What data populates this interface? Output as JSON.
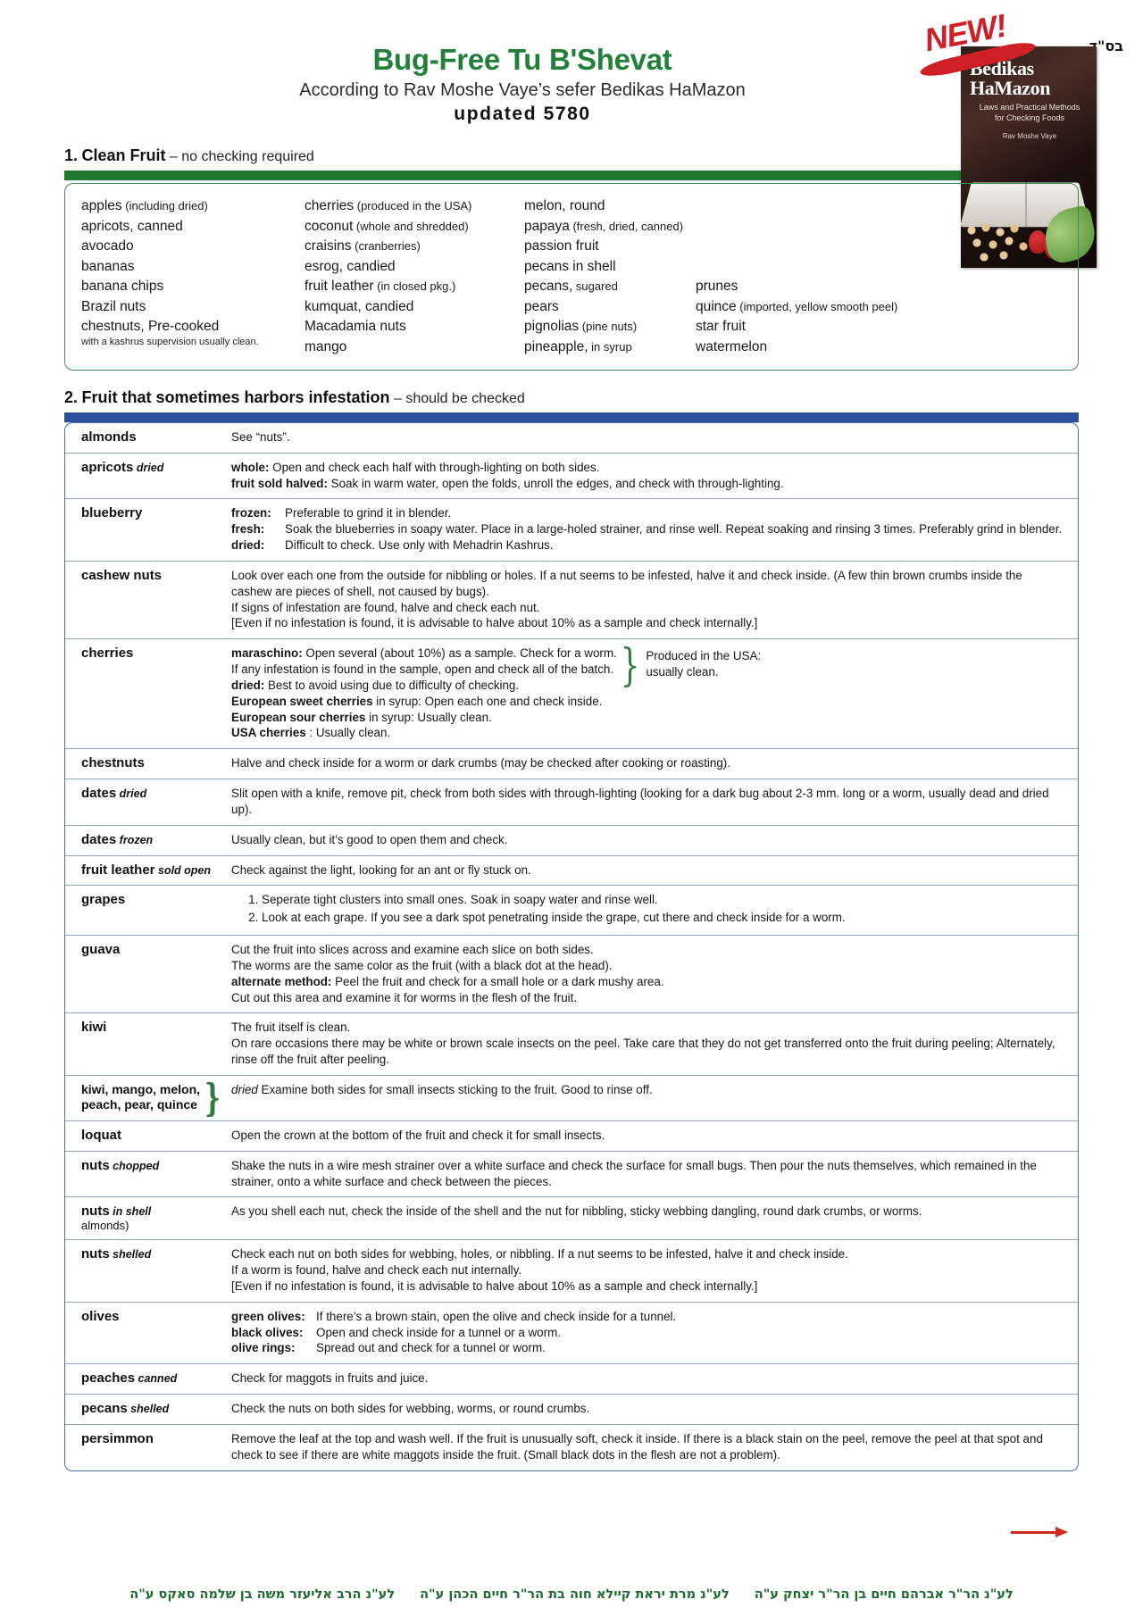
{
  "header": {
    "bsd": "בס\"ד",
    "title": "Bug-Free Tu B'Shevat",
    "subtitle": "According to Rav Moshe Vaye’s sefer Bedikas HaMazon",
    "updated": "updated 5780",
    "badge": "NEW!",
    "book": {
      "title_line1": "Bedikas",
      "title_line2": "HaMazon",
      "subtitle_line1": "Laws and Practical Methods",
      "subtitle_line2": "for Checking Foods",
      "author": "Rav Moshe Vaye"
    }
  },
  "section1": {
    "number": "1.",
    "title": "Clean Fruit",
    "note": "– no checking required",
    "columns": [
      [
        {
          "main": "apples",
          "small": "(including dried)"
        },
        {
          "main": "apricots, canned",
          "small": ""
        },
        {
          "main": "avocado",
          "small": ""
        },
        {
          "main": "bananas",
          "small": ""
        },
        {
          "main": "banana chips",
          "small": ""
        },
        {
          "main": "Brazil nuts",
          "small": ""
        },
        {
          "main": "chestnuts, Pre-cooked",
          "small": ""
        }
      ],
      [
        {
          "main": "cherries",
          "small": "(produced in the USA)"
        },
        {
          "main": "coconut",
          "small": "(whole and shredded)"
        },
        {
          "main": "craisins",
          "small": "(cranberries)"
        },
        {
          "main": "esrog, candied",
          "small": ""
        },
        {
          "main": "fruit leather",
          "small": "(in closed pkg.)"
        },
        {
          "main": "kumquat, candied",
          "small": ""
        },
        {
          "main": "Macadamia nuts",
          "small": ""
        },
        {
          "main": "mango",
          "small": ""
        }
      ],
      [
        {
          "main": "melon, round",
          "small": ""
        },
        {
          "main": "papaya",
          "small": "(fresh, dried, canned)"
        },
        {
          "main": "passion fruit",
          "small": ""
        },
        {
          "main": "pecans in shell",
          "small": ""
        },
        {
          "main": "pecans,",
          "small": "sugared"
        },
        {
          "main": "pears",
          "small": ""
        },
        {
          "main": "pignolias",
          "small": "(pine nuts)"
        },
        {
          "main": "pineapple,",
          "small": "in syrup"
        }
      ],
      [
        {
          "main": "",
          "small": ""
        },
        {
          "main": "",
          "small": ""
        },
        {
          "main": "",
          "small": ""
        },
        {
          "main": "",
          "small": ""
        },
        {
          "main": "prunes",
          "small": ""
        },
        {
          "main": "quince",
          "small": "(imported, yellow smooth peel)"
        },
        {
          "main": "star fruit",
          "small": ""
        },
        {
          "main": "watermelon",
          "small": ""
        }
      ]
    ],
    "chestnut_note": "with a kashrus supervision usually clean."
  },
  "section2": {
    "number": "2.",
    "title": "Fruit that sometimes harbors infestation",
    "note": "– should be checked",
    "rows": [
      {
        "key": "almonds",
        "key_italic": "",
        "lines": [
          {
            "text": "See “nuts”."
          }
        ]
      },
      {
        "key": "apricots",
        "key_italic": "dried",
        "lines": [
          {
            "label": "whole:",
            "text": "Open and check each half with through-lighting on both sides."
          },
          {
            "label": "fruit sold halved:",
            "text": "Soak in warm water, open the folds, unroll the edges, and check with through-lighting."
          }
        ]
      },
      {
        "key": "blueberry",
        "key_italic": "",
        "aligned": true,
        "lines": [
          {
            "label": "frozen:",
            "text": "Preferable to grind it in blender."
          },
          {
            "label": "fresh:",
            "text": "Soak the blueberries in soapy water. Place in a large-holed strainer, and rinse well. Repeat soaking and rinsing 3 times. Preferably grind in blender."
          },
          {
            "label": "dried:",
            "text": "Difficult to check. Use only with Mehadrin Kashrus."
          }
        ]
      },
      {
        "key": "cashew nuts",
        "key_italic": "",
        "lines": [
          {
            "text": "Look over each one from the outside for nibbling or holes. If a nut seems to be infested, halve it and check inside. (A few thin brown crumbs inside the cashew are pieces of shell, not caused by bugs)."
          },
          {
            "text": "If signs of infestation are found, halve and check each nut."
          },
          {
            "text": "[Even if no infestation is found, it is advisable to halve about 10% as a sample and check internally.]"
          }
        ]
      },
      {
        "key": "cherries",
        "key_italic": "",
        "brace_note_line1": "Produced in the USA:",
        "brace_note_line2": "usually clean.",
        "lines": [
          {
            "label": "maraschino:",
            "text": "Open several (about 10%) as a sample. Check for a worm."
          },
          {
            "text": "If any infestation is found in the sample, open and check all of the batch."
          },
          {
            "label": "dried:",
            "text": "Best to avoid using due to difficulty of checking."
          },
          {
            "label": "European sweet cherries",
            "text": "in syrup: Open each one and check inside."
          },
          {
            "label": "European sour cherries",
            "text": "in syrup: Usually clean."
          },
          {
            "label": "USA cherries",
            "text": ": Usually clean."
          }
        ]
      },
      {
        "key": "chestnuts",
        "key_italic": "",
        "lines": [
          {
            "text": "Halve and check inside for a worm or dark crumbs (may be checked after cooking or roasting)."
          }
        ]
      },
      {
        "key": "dates",
        "key_italic": "dried",
        "lines": [
          {
            "text": "Slit open with a knife, remove pit, check from both sides  with through-lighting (looking for a dark bug about 2-3 mm. long or a worm, usually dead and dried up)."
          }
        ]
      },
      {
        "key": "dates",
        "key_italic": "frozen",
        "lines": [
          {
            "text": "Usually clean, but it’s good to open them and check."
          }
        ]
      },
      {
        "key": "fruit leather",
        "key_italic": "sold open",
        "wide_key": true,
        "lines": [
          {
            "text": "Check against the light, looking for an ant or fly stuck on."
          }
        ]
      },
      {
        "key": "grapes",
        "key_italic": "",
        "ordered": [
          "Seperate tight clusters into small ones. Soak in soapy water and rinse well.",
          "Look at each grape. If you see a dark spot penetrating inside the grape, cut there and check inside for a worm."
        ]
      },
      {
        "key": "guava",
        "key_italic": "",
        "lines": [
          {
            "text": "Cut the fruit into slices across and examine each slice on both sides."
          },
          {
            "text": "The worms are the same color as the fruit (with a black dot at the head)."
          },
          {
            "label": "alternate method:",
            "text": "Peel the fruit and check for a small hole or a dark  mushy area."
          },
          {
            "text": "Cut out this area and examine it for worms in the flesh of the fruit."
          }
        ]
      },
      {
        "key": "kiwi",
        "key_italic": "",
        "lines": [
          {
            "text": "The fruit itself is clean."
          },
          {
            "text": "On rare occasions there may be white or brown scale insects on the peel. Take care that they do not get transferred onto the fruit during peeling; Alternately, rinse off the fruit after peeling."
          }
        ]
      },
      {
        "key_group_line1": "kiwi, mango, melon,",
        "key_group_line2": "peach, pear, quince",
        "group": true,
        "inline_italic": "dried",
        "lines": [
          {
            "text": "Examine both sides for small insects sticking to the fruit. Good to rinse off."
          }
        ]
      },
      {
        "key": "loquat",
        "key_italic": "",
        "lines": [
          {
            "text": "Open the crown at the bottom of the fruit and check it for small insects."
          }
        ]
      },
      {
        "key": "nuts",
        "key_italic": "chopped",
        "lines": [
          {
            "text": "Shake the nuts in a wire mesh strainer over a white surface and check the  surface for small bugs. Then pour the nuts themselves, which remained in the strainer, onto a white surface and check between the pieces."
          }
        ]
      },
      {
        "key": "nuts",
        "key_italic": "in shell",
        "key_line2": "almonds)",
        "lines": [
          {
            "text": "As you shell each nut, check the inside of the shell and the nut for nibbling, sticky webbing dangling, round dark crumbs, or worms."
          }
        ]
      },
      {
        "key": "nuts",
        "key_italic": "shelled",
        "lines": [
          {
            "text": "Check each nut on both sides for webbing, holes, or nibbling.  If a nut seems to be infested, halve it and check inside."
          },
          {
            "text": "If a worm is found, halve and check each nut internally."
          },
          {
            "text": "[Even if no infestation is found, it is advisable to halve about 10% as a sample and check internally.]"
          }
        ]
      },
      {
        "key": "olives",
        "key_italic": "",
        "aligned": true,
        "lines": [
          {
            "label": "green olives:",
            "text": "If there’s a brown stain, open the olive and check inside for a tunnel."
          },
          {
            "label": "black olives:",
            "text": "Open and check inside for a tunnel or a worm."
          },
          {
            "label": "olive rings:",
            "text": "Spread out and check for a tunnel or worm."
          }
        ]
      },
      {
        "key": "peaches",
        "key_italic": "canned",
        "lines": [
          {
            "text": "Check for maggots in fruits and juice."
          }
        ]
      },
      {
        "key": "pecans",
        "key_italic": "shelled",
        "lines": [
          {
            "text": "Check the nuts on both sides for webbing, worms, or round crumbs."
          }
        ]
      },
      {
        "key": "persimmon",
        "key_italic": "",
        "lines": [
          {
            "text": "Remove the leaf at the top and wash well. If the fruit is unusually soft, check it inside. If there is a black stain on the peel, remove the peel at that spot and check to see if there are white maggots inside the fruit. (Small black dots in the flesh are not a problem)."
          }
        ]
      }
    ]
  },
  "footer": {
    "items": [
      "לע\"נ הר\"ר אברהם חיים בן הר\"ר יצחק ע\"ה",
      "לע\"נ מרת יראת קיילא חוה בת הר\"ר חיים הכהן ע\"ה",
      "לע\"נ הרב אליעזר משה בן שלמה סאקס ע\"ה"
    ]
  },
  "colors": {
    "green": "#20772f",
    "blue": "#2a4f9b",
    "red": "#cf2027",
    "title_green": "#21803a"
  }
}
